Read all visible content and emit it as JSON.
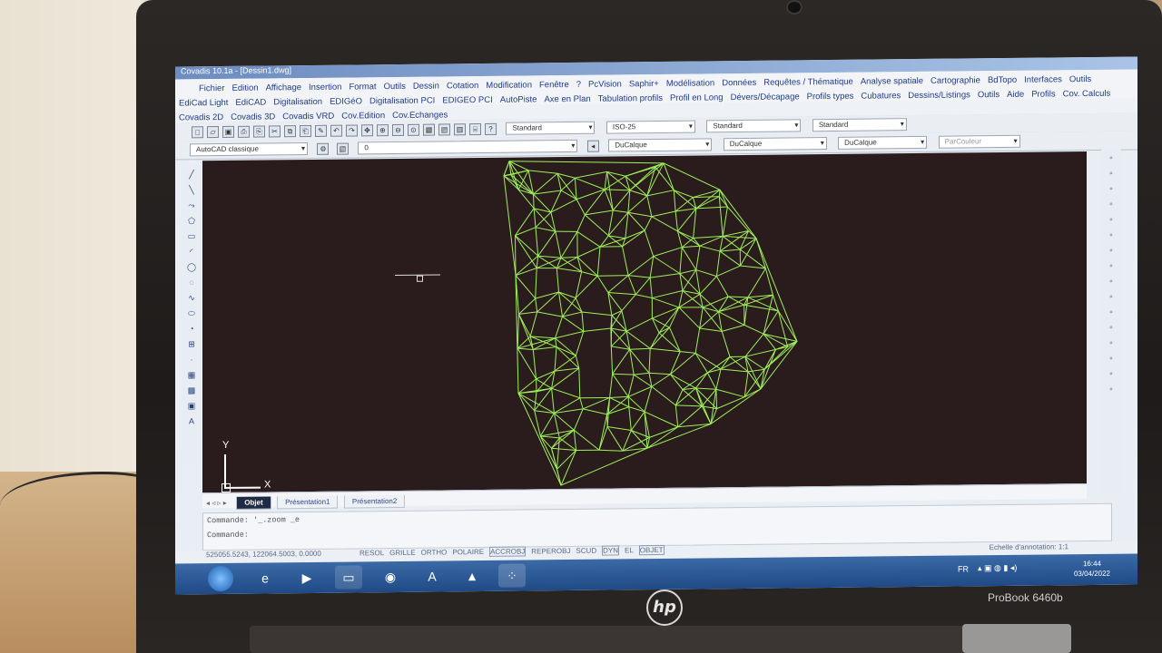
{
  "window": {
    "title": "Covadis 10.1a - [Dessin1.dwg]"
  },
  "menus": {
    "row1": [
      "Fichier",
      "Edition",
      "Affichage",
      "Insertion",
      "Format",
      "Outils",
      "Dessin",
      "Cotation",
      "Modification",
      "Fenêtre",
      "?",
      "PcVision",
      "Saphir+",
      "Modélisation",
      "Données",
      "Requêtes / Thématique",
      "Analyse spatiale",
      "Cartographie",
      "BdTopo",
      "Interfaces",
      "Outils"
    ],
    "row2": [
      "EdiCad Light",
      "EdiCAD",
      "Digitalisation",
      "EDIGéO",
      "Digitalisation PCI",
      "EDIGEO PCI",
      "AutoPiste",
      "Axe en Plan",
      "Tabulation profils",
      "Profil en Long",
      "Dévers/Décapage",
      "Profils types",
      "Cubatures",
      "Dessins/Listings",
      "Outils",
      "Aide",
      "Profils",
      "Cov. Calculs"
    ],
    "row3": [
      "Covadis 2D",
      "Covadis 3D",
      "Covadis VRD",
      "Cov.Edition",
      "Cov.Echanges"
    ]
  },
  "toolbar": {
    "text_style": "Standard",
    "dim_style": "ISO-25",
    "table_style": "Standard",
    "multileader_style": "Standard",
    "workspace": "AutoCAD classique",
    "layer": "0",
    "color": "DuCalque",
    "linetype": "DuCalque",
    "lineweight": "DuCalque",
    "plotstyle": "ParCouleur"
  },
  "tabs": [
    "Objet",
    "Présentation1",
    "Présentation2"
  ],
  "command": {
    "line1": "Commande: '_.zoom _e",
    "line2": "Commande:"
  },
  "status": {
    "coords": "525055.5243, 122064.5003, 0.0000",
    "toggles": [
      "RESOL",
      "GRILLE",
      "ORTHO",
      "POLAIRE",
      "ACCROBJ",
      "REPEROBJ",
      "SCUD",
      "DYN",
      "EL",
      "OBJET"
    ],
    "annotation_scale": "Echelle d'annotation: 1:1"
  },
  "axes": {
    "x": "X",
    "y": "Y"
  },
  "taskbar": {
    "lang": "FR",
    "time": "16:44",
    "date": "03/04/2022"
  },
  "laptop": {
    "brand": "hp",
    "model": "ProBook 6460b"
  },
  "colors": {
    "mesh": "#9ef05a",
    "canvas": "#2a1c1c",
    "menu_text": "#1f3b8a"
  },
  "icons": [
    "start-orb-icon",
    "ie-icon",
    "media-icon",
    "folder-icon",
    "chrome-icon",
    "acrobat-icon",
    "autocad-icon",
    "grid-app-icon"
  ]
}
